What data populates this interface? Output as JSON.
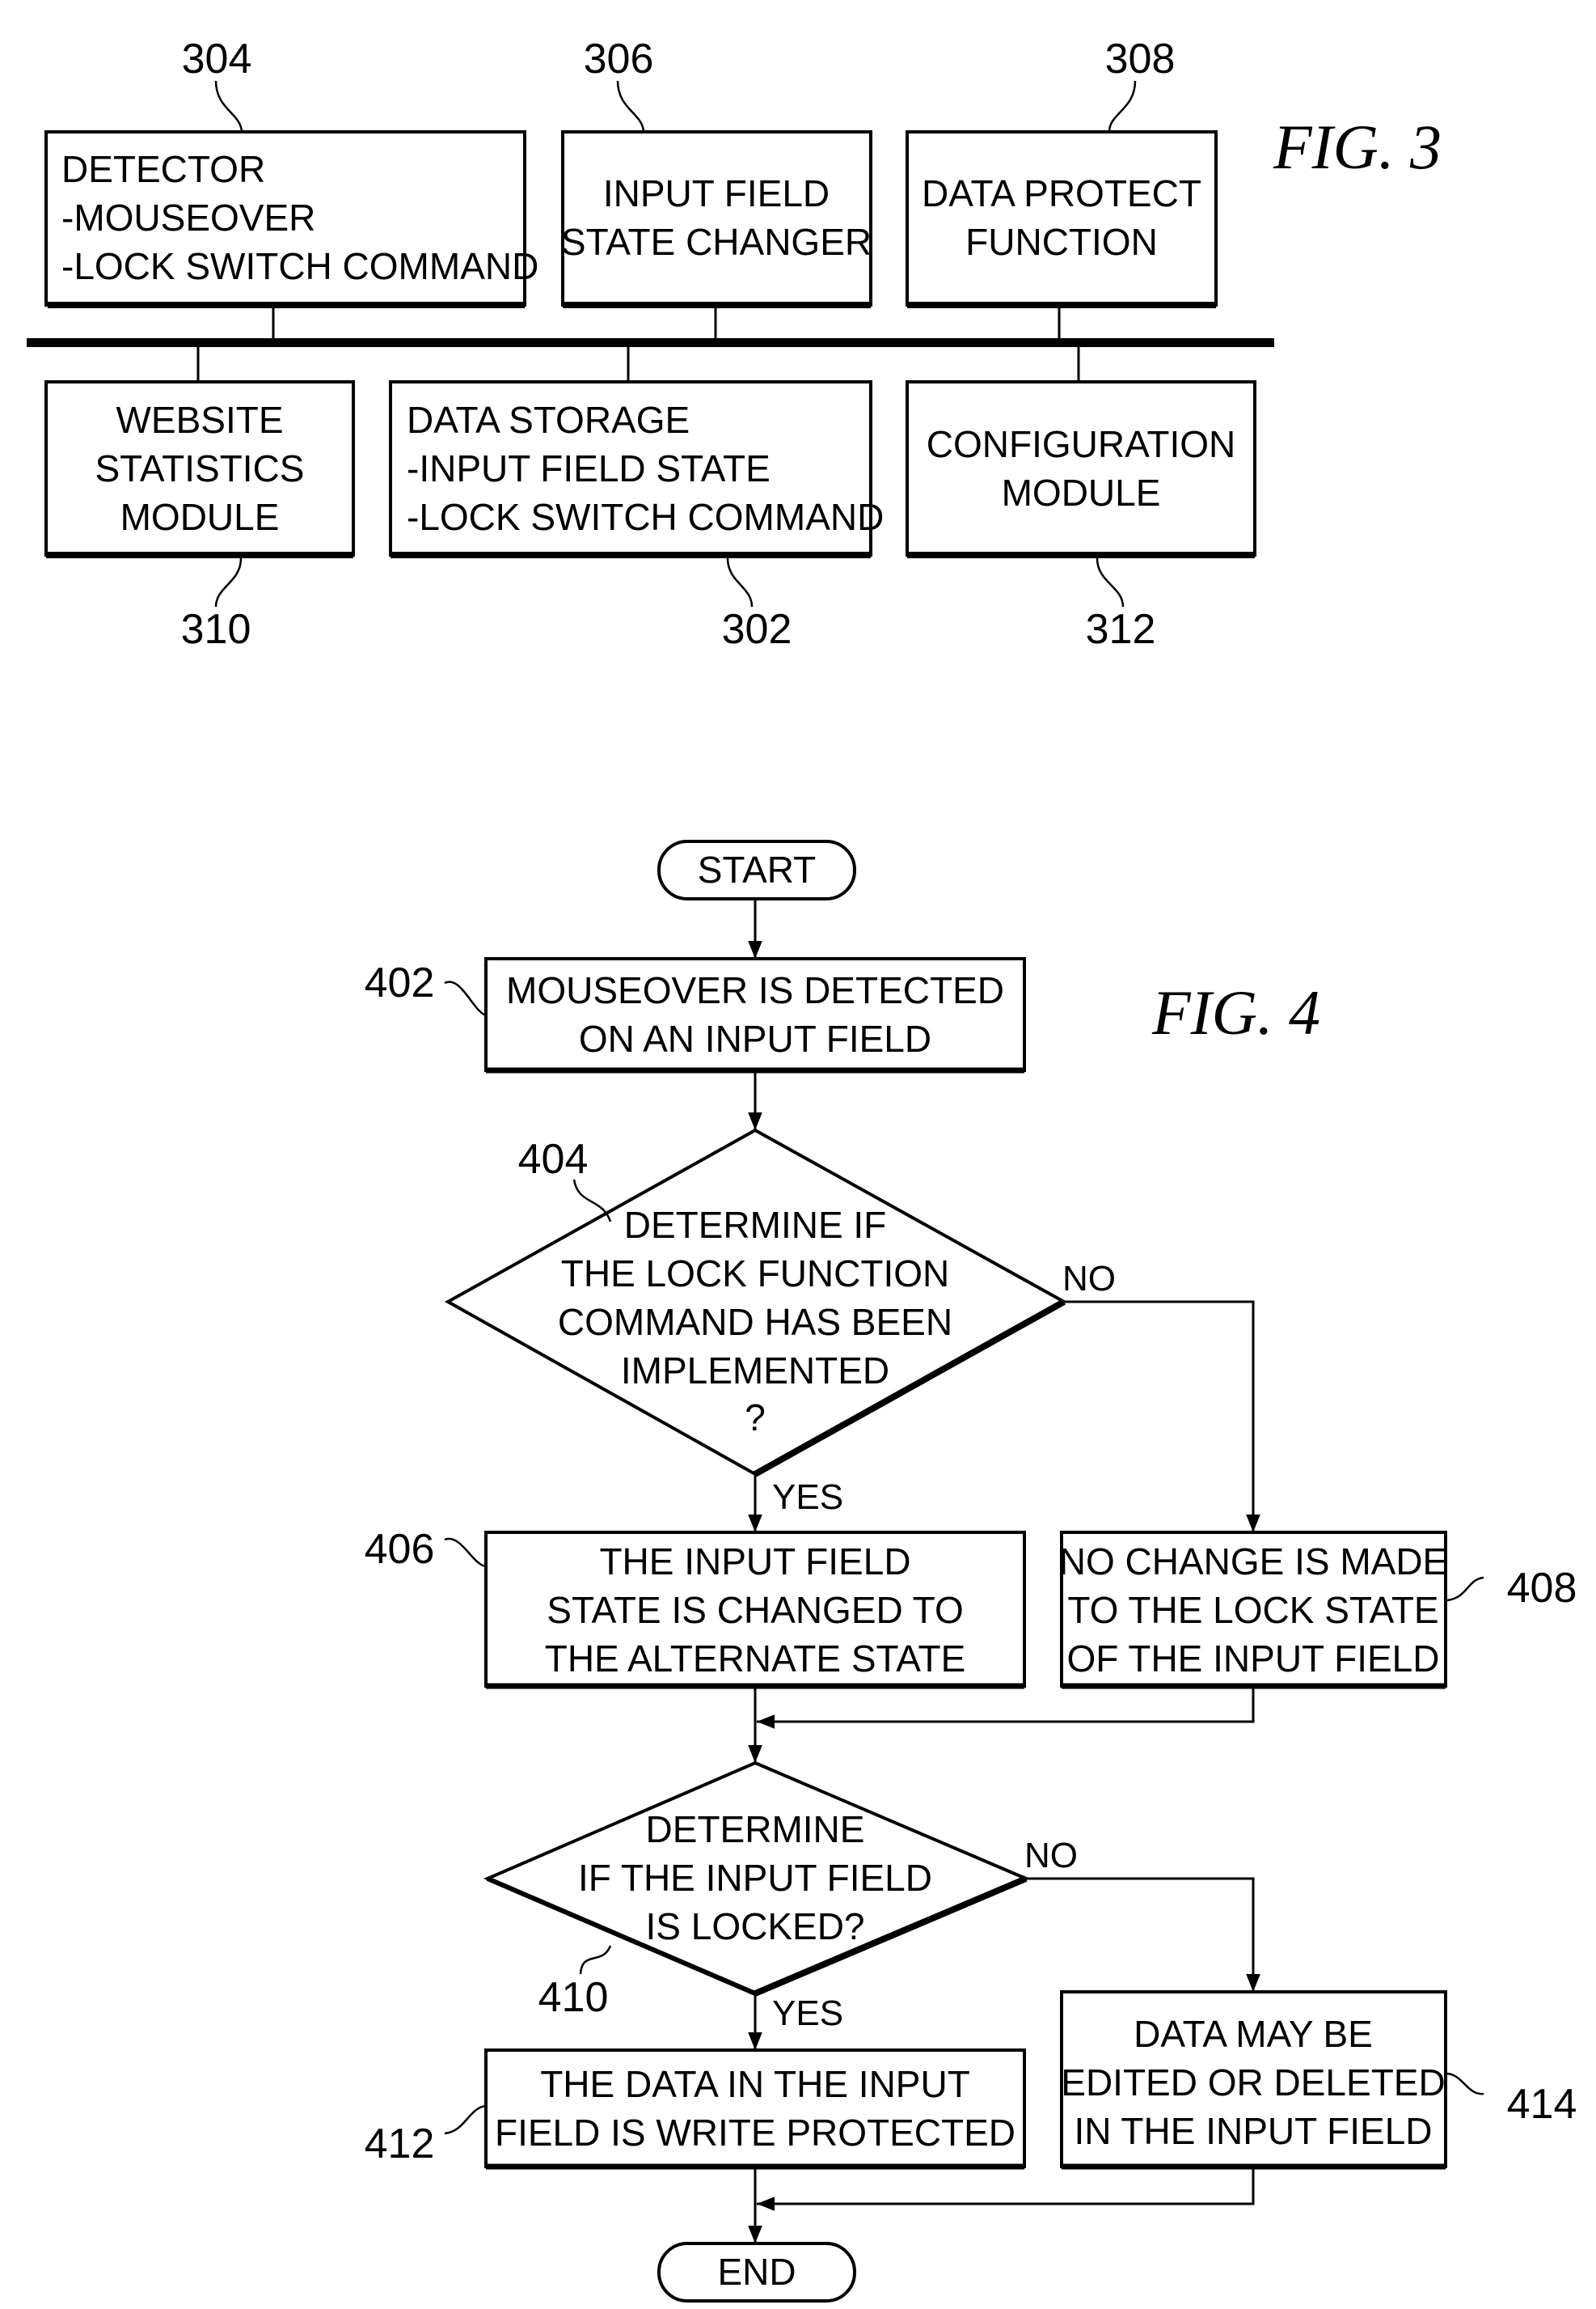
{
  "figure3": {
    "title": "FIG. 3",
    "bus": "system-bus",
    "blocks": [
      {
        "id": "detector",
        "ref": "304",
        "lines": [
          "DETECTOR",
          "-MOUSEOVER",
          "-LOCK SWITCH COMMAND"
        ],
        "align": "left"
      },
      {
        "id": "input-field-state-changer",
        "ref": "306",
        "lines": [
          "INPUT FIELD",
          "STATE CHANGER"
        ],
        "align": "center"
      },
      {
        "id": "data-protect-function",
        "ref": "308",
        "lines": [
          "DATA PROTECT",
          "FUNCTION"
        ],
        "align": "center"
      },
      {
        "id": "website-statistics-module",
        "ref": "310",
        "lines": [
          "WEBSITE",
          "STATISTICS",
          "MODULE"
        ],
        "align": "center"
      },
      {
        "id": "data-storage",
        "ref": "302",
        "lines": [
          "DATA STORAGE",
          "-INPUT FIELD STATE",
          "-LOCK SWITCH COMMAND"
        ],
        "align": "left"
      },
      {
        "id": "configuration-module",
        "ref": "312",
        "lines": [
          "CONFIGURATION",
          "MODULE"
        ],
        "align": "center"
      }
    ]
  },
  "figure4": {
    "title": "FIG. 4",
    "start": "START",
    "end": "END",
    "steps": [
      {
        "id": "step-402",
        "ref": "402",
        "type": "process",
        "lines": [
          "MOUSEOVER IS DETECTED",
          "ON AN INPUT FIELD"
        ]
      },
      {
        "id": "step-404",
        "ref": "404",
        "type": "decision",
        "lines": [
          "DETERMINE IF",
          "THE LOCK FUNCTION",
          "COMMAND HAS BEEN",
          "IMPLEMENTED",
          "?"
        ]
      },
      {
        "id": "step-406",
        "ref": "406",
        "type": "process",
        "lines": [
          "THE INPUT FIELD",
          "STATE IS CHANGED TO",
          "THE ALTERNATE STATE"
        ]
      },
      {
        "id": "step-408",
        "ref": "408",
        "type": "process",
        "lines": [
          "NO CHANGE IS MADE",
          "TO THE LOCK STATE",
          "OF THE INPUT FIELD"
        ]
      },
      {
        "id": "step-410",
        "ref": "410",
        "type": "decision",
        "lines": [
          "DETERMINE",
          "IF THE INPUT FIELD",
          "IS LOCKED?"
        ]
      },
      {
        "id": "step-412",
        "ref": "412",
        "type": "process",
        "lines": [
          "THE DATA IN THE INPUT",
          "FIELD IS WRITE PROTECTED"
        ]
      },
      {
        "id": "step-414",
        "ref": "414",
        "type": "process",
        "lines": [
          "DATA MAY BE",
          "EDITED OR DELETED",
          "IN THE INPUT FIELD"
        ]
      }
    ],
    "branch_labels": {
      "d404_yes": "YES",
      "d404_no": "NO",
      "d410_yes": "YES",
      "d410_no": "NO"
    }
  }
}
